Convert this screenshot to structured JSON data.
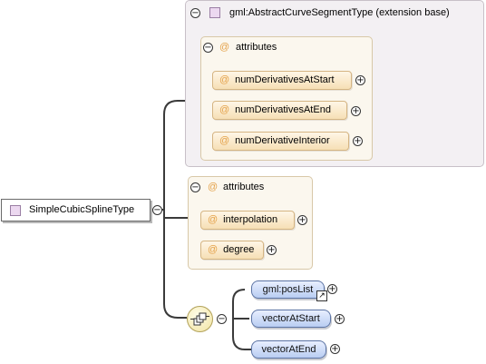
{
  "root": {
    "label": "SimpleCubicSplineType"
  },
  "base": {
    "label": "gml:AbstractCurveSegmentType (extension base)"
  },
  "base_attributes": {
    "title": "attributes",
    "items": [
      {
        "label": "numDerivativesAtStart"
      },
      {
        "label": "numDerivativesAtEnd"
      },
      {
        "label": "numDerivativeInterior"
      }
    ]
  },
  "own_attributes": {
    "title": "attributes",
    "items": [
      {
        "label": "interpolation"
      },
      {
        "label": "degree"
      }
    ]
  },
  "sequence": {
    "elements": [
      {
        "label": "gml:posList"
      },
      {
        "label": "vectorAtStart"
      },
      {
        "label": "vectorAtEnd"
      }
    ]
  },
  "symbols": {
    "collapse": "−",
    "expand": "+",
    "at": "@",
    "reference_arrow": "↗"
  },
  "colors": {
    "element_fill": "#c8d8f5",
    "attribute_fill": "#fbe8c4",
    "group_fill": "#f3f0f3",
    "type_icon": "#ecd8f0",
    "connector": "#3a3a3a"
  }
}
